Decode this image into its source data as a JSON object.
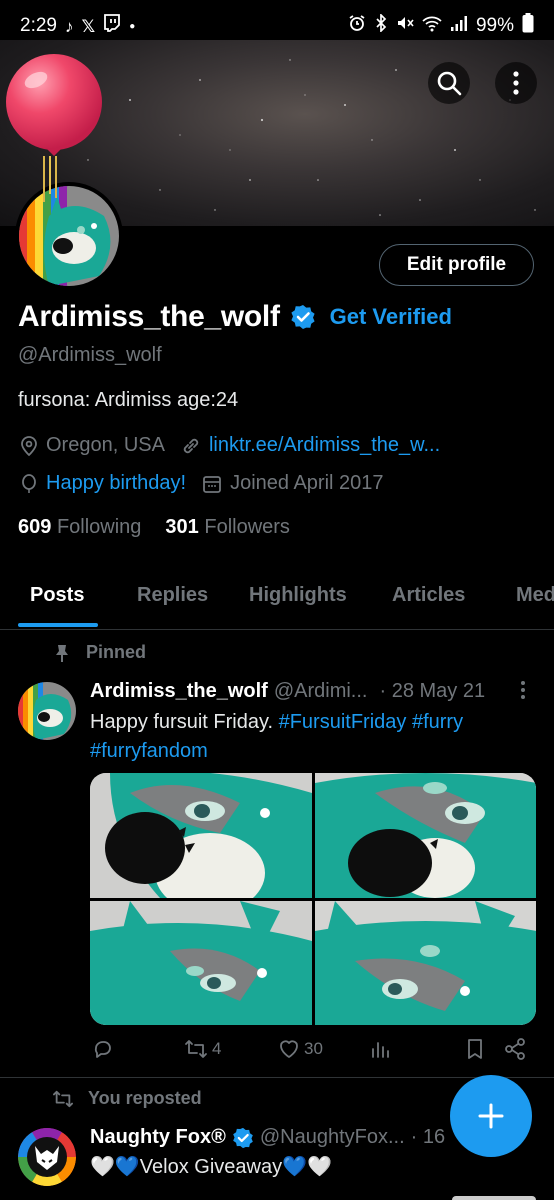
{
  "status_bar": {
    "time": "2:29",
    "battery": "99%",
    "left_icons": [
      "tiktok-icon",
      "x-icon",
      "twitch-icon"
    ],
    "right_icons": [
      "alarm-icon",
      "bluetooth-icon",
      "mute-icon",
      "wifi-icon",
      "signal-icon",
      "battery-icon"
    ]
  },
  "header": {
    "search_icon": "search-icon",
    "more_icon": "more-vertical-icon"
  },
  "profile": {
    "edit_label": "Edit profile",
    "display_name": "Ardimiss_the_wolf",
    "verified_badge": "verified-badge-icon",
    "get_verified": "Get Verified",
    "handle": "@Ardimiss_wolf",
    "bio": "fursona: Ardimiss age:24",
    "location": "Oregon, USA",
    "link": "linktr.ee/Ardimiss_the_w...",
    "birthday": "Happy birthday!",
    "joined": "Joined April 2017",
    "following_count": "609",
    "following_label": "Following",
    "followers_count": "301",
    "followers_label": "Followers"
  },
  "tabs": [
    {
      "label": "Posts",
      "active": true
    },
    {
      "label": "Replies",
      "active": false
    },
    {
      "label": "Highlights",
      "active": false
    },
    {
      "label": "Articles",
      "active": false
    },
    {
      "label": "Med",
      "active": false
    }
  ],
  "pinned_post": {
    "pinned_label": "Pinned",
    "author": "Ardimiss_the_wolf",
    "handle": "@Ardimi...",
    "date": "· 28 May 21",
    "text": "Happy fursuit Friday. ",
    "hashtag1": "#FursuitFriday",
    "hashtag2": "#furry",
    "hashtag3": "#furryfandom",
    "replies": "",
    "reposts": "4",
    "likes": "30",
    "views": ""
  },
  "repost": {
    "label": "You reposted",
    "author": "Naughty Fox®",
    "handle": "@NaughtyFox...",
    "date": "· 16",
    "text": "🤍💙Velox Giveaway💙🤍"
  },
  "colors": {
    "accent": "#1d9bf0",
    "background": "#000000",
    "secondary_text": "#71767b",
    "fur_teal": "#1aa896"
  }
}
